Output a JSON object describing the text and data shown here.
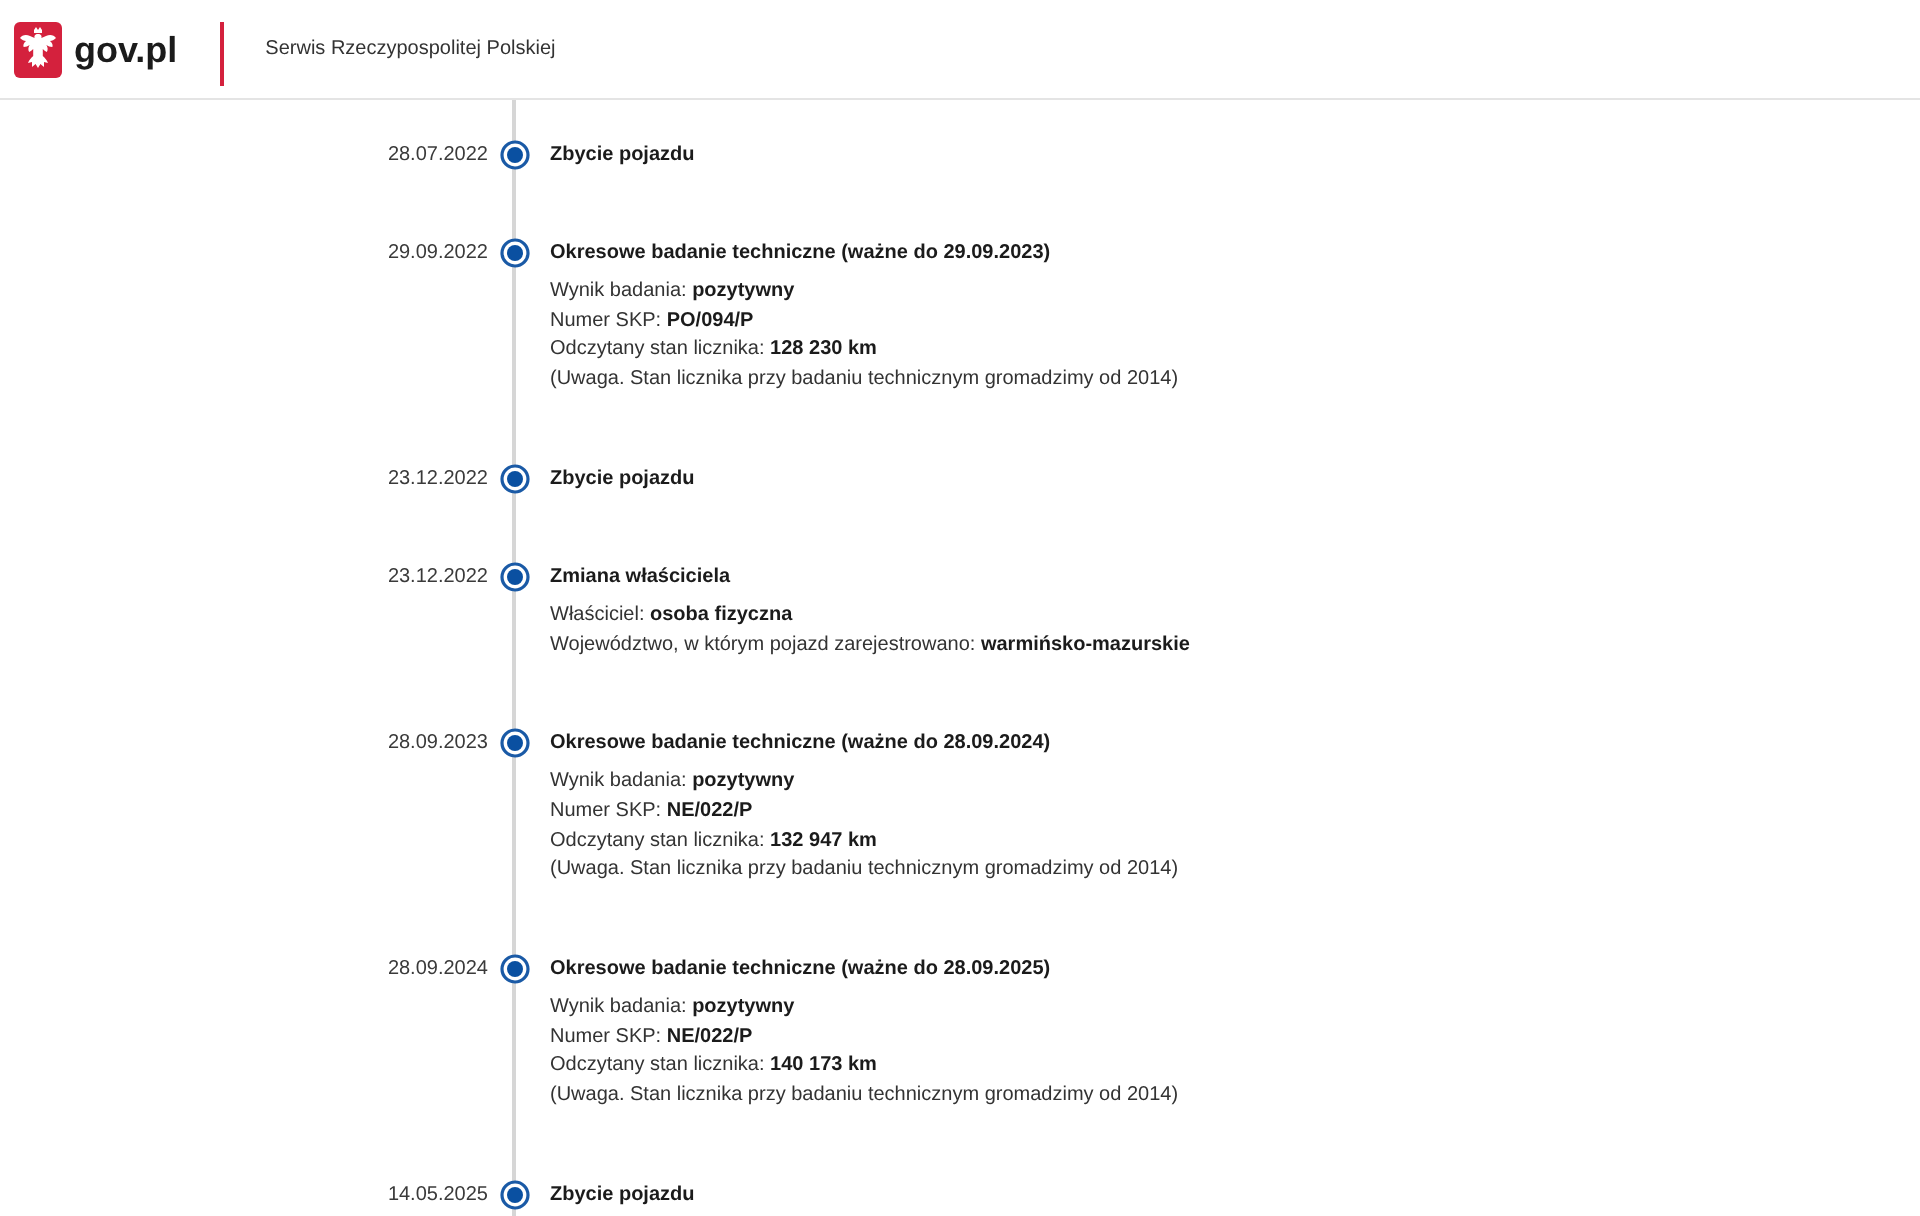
{
  "header": {
    "logo_text": "gov.pl",
    "service_title": "Serwis Rzeczypospolitej Polskiej"
  },
  "events": [
    {
      "date": "28.07.2022",
      "title": "Zbycie pojazdu"
    },
    {
      "date": "29.09.2022",
      "title": "Okresowe badanie techniczne (ważne do 29.09.2023)",
      "details": [
        "Wynik badania: **pozytywny**",
        "Numer SKP: **PO/094/P**",
        "Odczytany stan licznika: **128 230 km**",
        "(Uwaga. Stan licznika przy badaniu technicznym gromadzimy od 2014)"
      ]
    },
    {
      "date": "23.12.2022",
      "title": "Zbycie pojazdu"
    },
    {
      "date": "23.12.2022",
      "title": "Zmiana właściciela",
      "details": [
        "Właściciel: **osoba fizyczna**",
        "Województwo, w którym pojazd zarejestrowano: **warmińsko-mazurskie**"
      ]
    },
    {
      "date": "28.09.2023",
      "title": "Okresowe badanie techniczne (ważne do 28.09.2024)",
      "details": [
        "Wynik badania: **pozytywny**",
        "Numer SKP: **NE/022/P**",
        "Odczytany stan licznika: **132 947 km**",
        "(Uwaga. Stan licznika przy badaniu technicznym gromadzimy od 2014)"
      ]
    },
    {
      "date": "28.09.2024",
      "title": "Okresowe badanie techniczne (ważne do 28.09.2025)",
      "details": [
        "Wynik badania: **pozytywny**",
        "Numer SKP: **NE/022/P**",
        "Odczytany stan licznika: **140 173 km**",
        "(Uwaga. Stan licznika przy badaniu technicznym gromadzimy od 2014)"
      ]
    },
    {
      "date": "14.05.2025",
      "title": "Zbycie pojazdu"
    }
  ]
}
